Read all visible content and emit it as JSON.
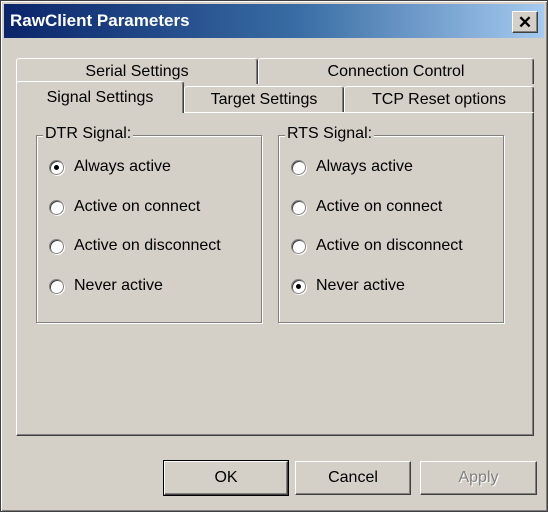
{
  "window": {
    "title": "RawClient Parameters",
    "close_glyph": "✕"
  },
  "tabs": {
    "back_row": [
      {
        "label": "Serial Settings"
      },
      {
        "label": "Connection Control"
      }
    ],
    "front_row": [
      {
        "label": "Signal Settings",
        "selected": true
      },
      {
        "label": "Target Settings"
      },
      {
        "label": "TCP Reset options"
      }
    ]
  },
  "dtr": {
    "label": "DTR Signal:",
    "options": [
      {
        "label": "Always active",
        "checked": true
      },
      {
        "label": "Active on connect",
        "checked": false
      },
      {
        "label": "Active on disconnect",
        "checked": false
      },
      {
        "label": "Never active",
        "checked": false
      }
    ]
  },
  "rts": {
    "label": "RTS Signal:",
    "options": [
      {
        "label": "Always active",
        "checked": false
      },
      {
        "label": "Active on connect",
        "checked": false
      },
      {
        "label": "Active on disconnect",
        "checked": false
      },
      {
        "label": "Never active",
        "checked": true
      }
    ]
  },
  "buttons": {
    "ok": "OK",
    "cancel": "Cancel",
    "apply": "Apply"
  },
  "icons": {
    "close": "close-icon",
    "radio_checked": "radio-checked-icon",
    "radio_unchecked": "radio-unchecked-icon"
  },
  "colors": {
    "face": "#d4d0c8",
    "title_start": "#0a246a",
    "title_end": "#a6caf0"
  }
}
